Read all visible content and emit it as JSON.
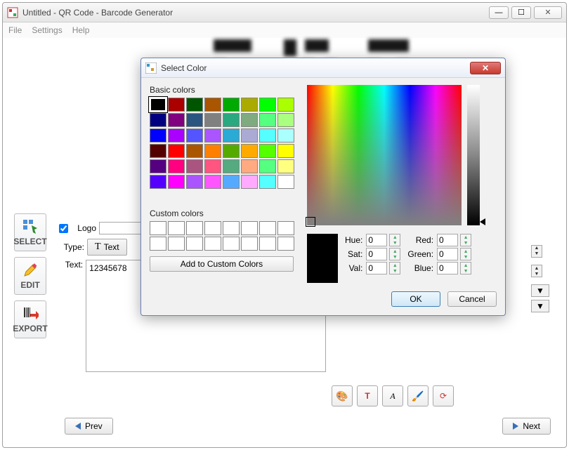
{
  "window": {
    "title": "Untitled - QR Code - Barcode Generator",
    "menus": {
      "file": "File",
      "settings": "Settings",
      "help": "Help"
    }
  },
  "left_tabs": {
    "select": "SELECT",
    "edit": "EDIT",
    "export": "EXPORT"
  },
  "form": {
    "logo_label": "Logo",
    "logo_checked": true,
    "logo_value": "",
    "type_label": "Type:",
    "type_button": "Text",
    "text_label": "Text:",
    "text_value": "12345678"
  },
  "nav": {
    "prev": "Prev",
    "next": "Next"
  },
  "toolbar_icons": {
    "palette": "palette-icon",
    "text_style": "text-style-icon",
    "font": "font-icon",
    "fill": "fill-icon",
    "refresh": "refresh-icon"
  },
  "color_dialog": {
    "title": "Select Color",
    "basic_label": "Basic colors",
    "custom_label": "Custom colors",
    "add_custom": "Add to Custom Colors",
    "ok": "OK",
    "cancel": "Cancel",
    "fields": {
      "hue": {
        "label": "Hue:",
        "value": "0"
      },
      "sat": {
        "label": "Sat:",
        "value": "0"
      },
      "val": {
        "label": "Val:",
        "value": "0"
      },
      "red": {
        "label": "Red:",
        "value": "0"
      },
      "green": {
        "label": "Green:",
        "value": "0"
      },
      "blue": {
        "label": "Blue:",
        "value": "0"
      }
    },
    "selected_preview": "#000000",
    "basic_colors": [
      "#000000",
      "#aa0000",
      "#005500",
      "#aa5500",
      "#00aa00",
      "#aaaa00",
      "#00ff00",
      "#aaff00",
      "#000080",
      "#800080",
      "#2a5580",
      "#808080",
      "#2aa87f",
      "#80aa80",
      "#55ff80",
      "#aaff80",
      "#0000ff",
      "#aa00ff",
      "#5555ff",
      "#aa55ff",
      "#2aaad4",
      "#aaaad4",
      "#55ffff",
      "#aaffff",
      "#550000",
      "#ff0000",
      "#aa5500",
      "#ff7f00",
      "#55aa00",
      "#ffaa00",
      "#55ff00",
      "#ffff00",
      "#550080",
      "#ff0080",
      "#aa5580",
      "#ff5580",
      "#55aa80",
      "#ffaa80",
      "#55ff80",
      "#ffff80",
      "#5500ff",
      "#ff00ff",
      "#aa55ff",
      "#ff55ff",
      "#55aaff",
      "#ffaaff",
      "#55ffff",
      "#ffffff"
    ]
  }
}
